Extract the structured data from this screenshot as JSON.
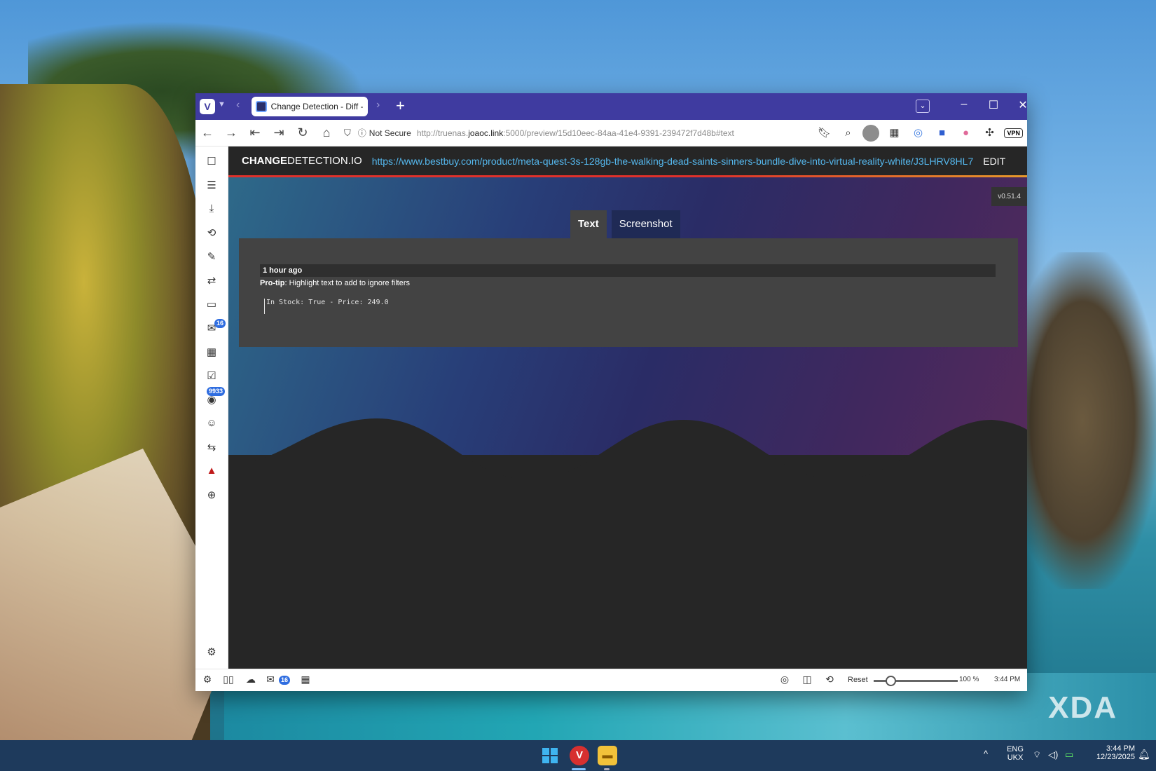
{
  "browser": {
    "tab_title": "Change Detection - Diff - M",
    "new_tab": "+",
    "security_label": "Not Secure",
    "url_prefix": "http://truenas.",
    "url_domain": "joaoc.link",
    "url_path": ":5000/preview/15d10eec-84aa-41e4-9391-239472f7d48b#text",
    "vpn_label": "VPN"
  },
  "app": {
    "logo_bold": "CHANGE",
    "logo_rest": "DETECTION.IO",
    "watch_url": "https://www.bestbuy.com/product/meta-quest-3s-128gb-the-walking-dead-saints-sinners-bundle-dive-into-virtual-reality-white/J3LHRV8HL7",
    "edit_label": "EDIT",
    "version": "v0.51.4",
    "tabs": [
      {
        "label": "Text",
        "active": true
      },
      {
        "label": "Screenshot",
        "active": false
      }
    ],
    "diff_time": "1 hour ago",
    "protip_bold": "Pro-tip",
    "protip_text": ": Highlight text to add to ignore filters",
    "diff_content": "In Stock: True - Price: 249.0"
  },
  "sidebar": {
    "mail_badge": "16",
    "feed_badge": "9933"
  },
  "statusbar": {
    "mail_badge": "16",
    "reset_label": "Reset",
    "zoom_value": 100,
    "zoom_label": "100 %",
    "time": "3:44 PM"
  },
  "taskbar": {
    "lang": "ENG",
    "layout": "UKX",
    "time": "3:44 PM",
    "date": "12/23/2025"
  },
  "watermark": "XDA",
  "colors": {
    "browser_accent": "#3f3ba0",
    "link": "#55b8ee",
    "header_border": "#e0312b"
  }
}
